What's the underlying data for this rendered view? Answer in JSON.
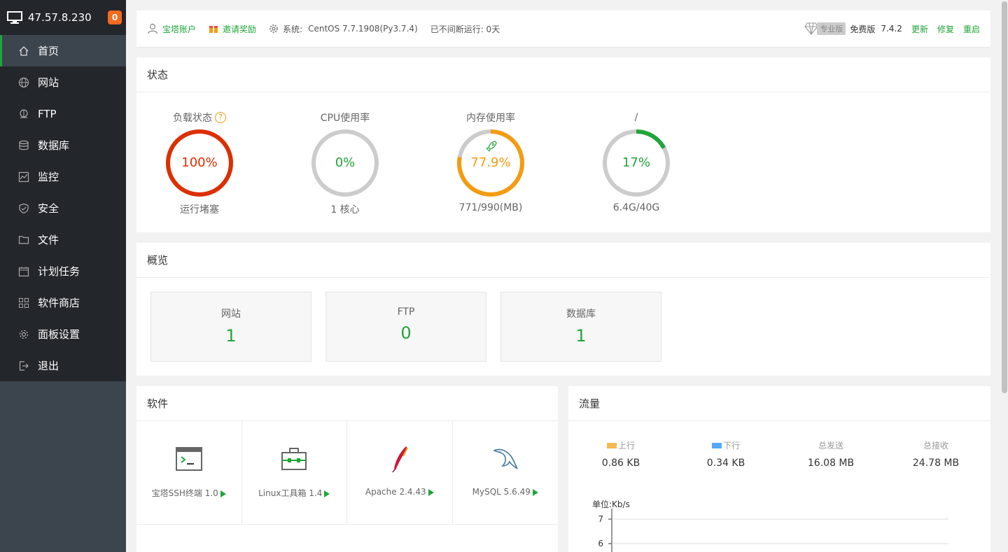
{
  "sidebar": {
    "ip": "47.57.8.230",
    "badge": "0",
    "items": [
      {
        "label": "首页",
        "icon": "home-icon"
      },
      {
        "label": "网站",
        "icon": "globe-icon"
      },
      {
        "label": "FTP",
        "icon": "ftp-icon"
      },
      {
        "label": "数据库",
        "icon": "database-icon"
      },
      {
        "label": "监控",
        "icon": "monitor-chart-icon"
      },
      {
        "label": "安全",
        "icon": "shield-icon"
      },
      {
        "label": "文件",
        "icon": "folder-icon"
      },
      {
        "label": "计划任务",
        "icon": "calendar-icon"
      },
      {
        "label": "软件商店",
        "icon": "grid-icon"
      },
      {
        "label": "面板设置",
        "icon": "gear-icon"
      },
      {
        "label": "退出",
        "icon": "logout-icon"
      }
    ]
  },
  "topbar": {
    "account": "宝塔账户",
    "invite": "邀请奖励",
    "system_label": "系统:",
    "system_value": "CentOS 7.7.1908(Py3.7.4)",
    "uptime": "已不间断运行: 0天",
    "pro_tag": "专业版",
    "edition": "免费版",
    "version": "7.4.2",
    "update": "更新",
    "repair": "修复",
    "restart": "重启"
  },
  "status": {
    "title": "状态",
    "gauges": [
      {
        "title": "负载状态",
        "value": "100%",
        "percent": 100,
        "sub": "运行堵塞",
        "color": "#dd2f00"
      },
      {
        "title": "CPU使用率",
        "value": "0%",
        "percent": 0,
        "sub": "1 核心",
        "color": "#20a53a"
      },
      {
        "title": "内存使用率",
        "value": "77.9%",
        "percent": 77.9,
        "sub": "771/990(MB)",
        "color": "#f39c12"
      },
      {
        "title": "/",
        "value": "17%",
        "percent": 17,
        "sub": "6.4G/40G",
        "color": "#20a53a"
      }
    ]
  },
  "overview": {
    "title": "概览",
    "cards": [
      {
        "label": "网站",
        "value": "1"
      },
      {
        "label": "FTP",
        "value": "0"
      },
      {
        "label": "数据库",
        "value": "1"
      }
    ]
  },
  "software": {
    "title": "软件",
    "items": [
      {
        "name": "宝塔SSH终端 1.0",
        "icon": "terminal-icon"
      },
      {
        "name": "Linux工具箱 1.4",
        "icon": "toolbox-icon"
      },
      {
        "name": "Apache 2.4.43",
        "icon": "apache-feather-icon"
      },
      {
        "name": "MySQL 5.6.49",
        "icon": "mysql-dolphin-icon"
      }
    ]
  },
  "traffic": {
    "title": "流量",
    "stats": [
      {
        "label": "上行",
        "value": "0.86 KB",
        "swatch": "#f7b851"
      },
      {
        "label": "下行",
        "value": "0.34 KB",
        "swatch": "#52a9ff"
      },
      {
        "label": "总发送",
        "value": "16.08 MB"
      },
      {
        "label": "总接收",
        "value": "24.78 MB"
      }
    ],
    "unit": "单位:Kb/s",
    "ticks": [
      "7",
      "6"
    ]
  },
  "colors": {
    "accent": "#20a53a",
    "sidebar": "#3c444d",
    "sidebar_dark": "#23262b",
    "badge": "#f7691d"
  }
}
